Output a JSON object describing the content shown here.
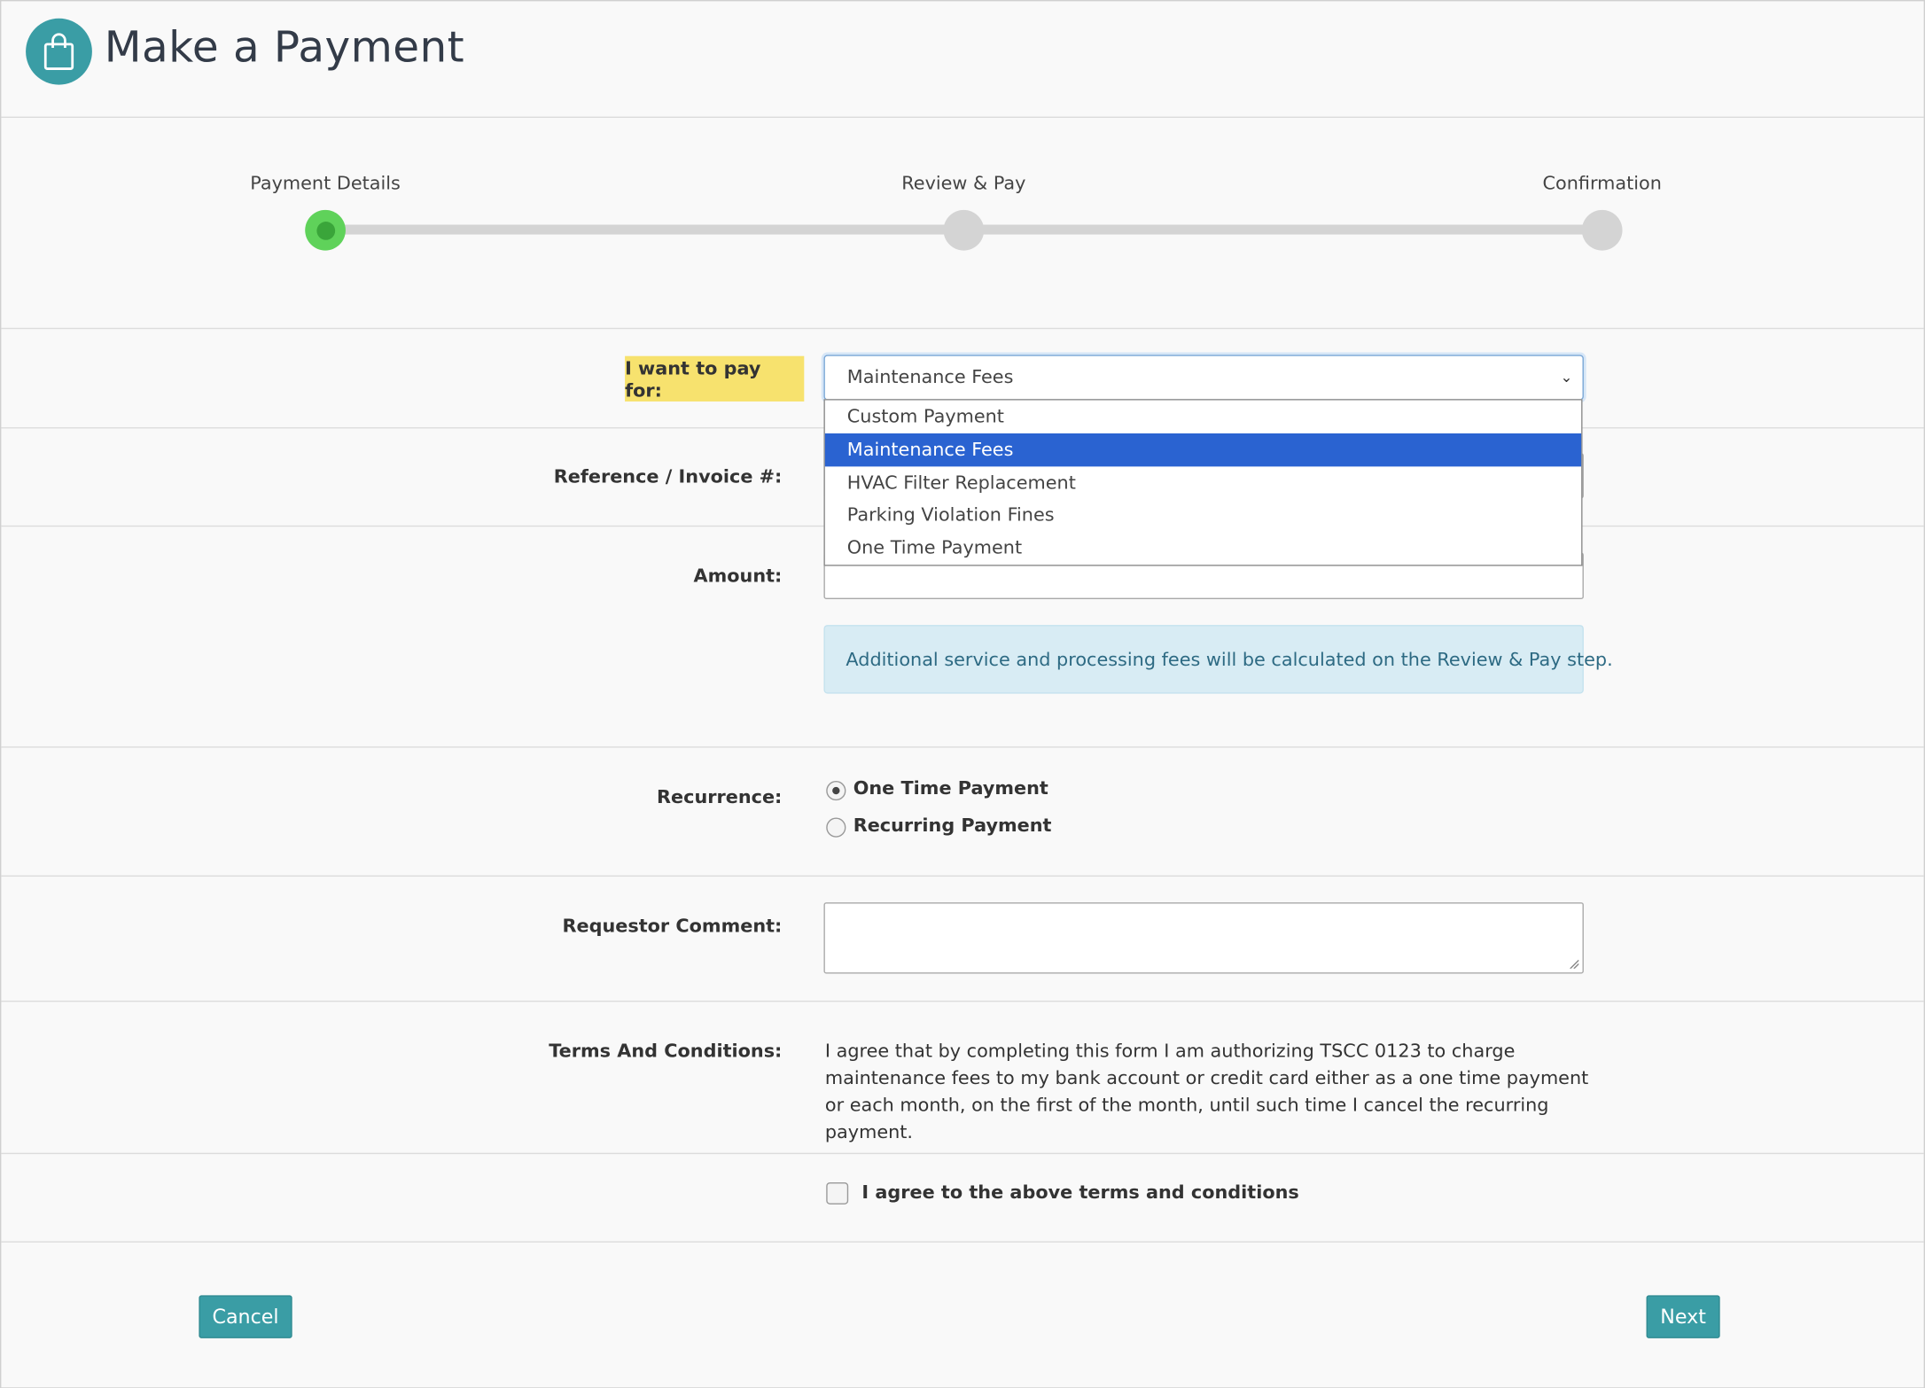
{
  "header": {
    "title": "Make a Payment",
    "icon": "shopping-bag-icon"
  },
  "stepper": {
    "steps": [
      {
        "label": "Payment Details",
        "state": "active"
      },
      {
        "label": "Review & Pay",
        "state": "pending"
      },
      {
        "label": "Confirmation",
        "state": "pending"
      }
    ]
  },
  "form": {
    "pay_for": {
      "label": "I want to pay for:",
      "selected": "Maintenance Fees",
      "options": [
        "Custom Payment",
        "Maintenance Fees",
        "HVAC Filter Replacement",
        "Parking Violation Fines",
        "One Time Payment"
      ]
    },
    "reference": {
      "label": "Reference / Invoice #:",
      "value": ""
    },
    "amount": {
      "label": "Amount:",
      "value": ""
    },
    "fee_notice": "Additional service and processing fees will be calculated on the Review & Pay step.",
    "recurrence": {
      "label": "Recurrence:",
      "options": [
        {
          "label": "One Time Payment",
          "checked": true
        },
        {
          "label": "Recurring Payment",
          "checked": false
        }
      ]
    },
    "comment": {
      "label": "Requestor Comment:",
      "value": ""
    },
    "terms": {
      "label": "Terms And Conditions:",
      "text": "I agree that by completing this form I am authorizing TSCC 0123 to charge maintenance fees to my bank account or credit card either as a one time payment or each month, on the first of the month, until such time I cancel the recurring payment."
    },
    "agree": {
      "label": "I agree to the above terms and conditions",
      "checked": false
    }
  },
  "actions": {
    "cancel_label": "Cancel",
    "next_label": "Next"
  },
  "colors": {
    "accent": "#3a9da5",
    "step_active": "#5fd25a",
    "highlight": "#f7e26e",
    "selected_option": "#2a63d1",
    "info_background": "#d8ecf4"
  }
}
